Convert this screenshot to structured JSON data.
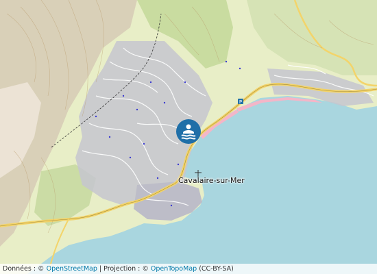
{
  "map": {
    "place_label": "Cavalaire-sur-Mer",
    "marker_icon": "swimming-icon",
    "colors": {
      "sea": "#a9d6df",
      "land": "#e8eec7",
      "forest": "#c9dca0",
      "urban": "#c5c5cf",
      "road_major": "#f3d46a",
      "road_minor": "#ffffff",
      "marker": "#1f6fa8",
      "beach": "#f3b6c8"
    }
  },
  "attribution": {
    "prefix": "Données : ©",
    "osm_link": "OpenStreetMap",
    "separator": "|",
    "projection_text": "Projection : ©",
    "topo_link": "OpenTopoMap",
    "license": "(CC-BY-SA)"
  }
}
